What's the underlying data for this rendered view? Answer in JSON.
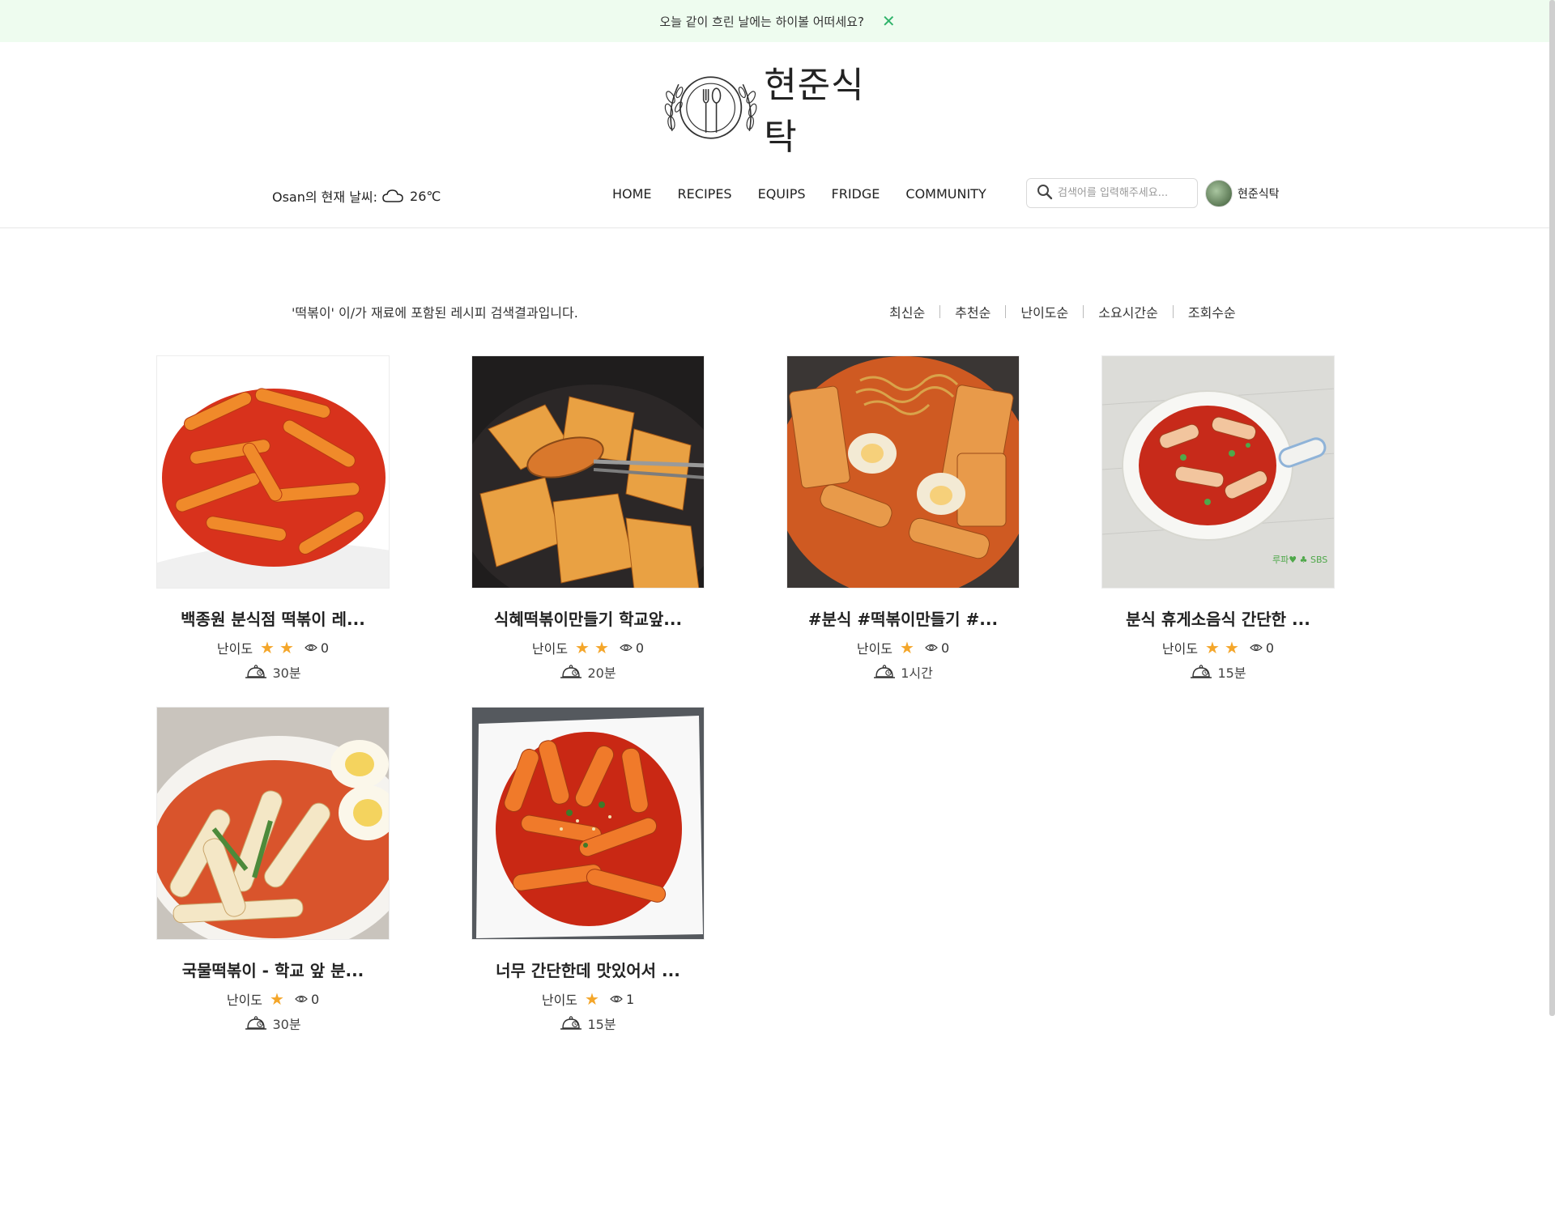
{
  "notice": {
    "text": "오늘 같이 흐린 날에는 하이볼 어떠세요?",
    "close": "✕"
  },
  "logo": {
    "text": "현준식탁"
  },
  "weather": {
    "label": "Osan의 현재 날씨:",
    "temp": "26℃"
  },
  "nav": {
    "home": "HOME",
    "recipes": "RECIPES",
    "equips": "EQUIPS",
    "fridge": "FRIDGE",
    "community": "COMMUNITY"
  },
  "search": {
    "placeholder": "검색어를 입력해주세요..."
  },
  "user": {
    "name": "현준식탁"
  },
  "result_text": "'떡볶이' 이/가 재료에 포함된 레시피 검색결과입니다.",
  "sort": {
    "latest": "최신순",
    "recommended": "추천순",
    "difficulty": "난이도순",
    "duration": "소요시간순",
    "views": "조회수순"
  },
  "difficulty_label": "난이도",
  "cards": [
    {
      "title": "백종원 분식점 떡볶이 레...",
      "stars": 2,
      "views": "0",
      "time": "30분"
    },
    {
      "title": "식혜떡볶이만들기 학교앞...",
      "stars": 2,
      "views": "0",
      "time": "20분"
    },
    {
      "title": "#분식 #떡볶이만들기 #...",
      "stars": 1,
      "views": "0",
      "time": "1시간"
    },
    {
      "title": "분식 휴게소음식 간단한 ...",
      "stars": 2,
      "views": "0",
      "time": "15분"
    },
    {
      "title": "국물떡볶이 - 학교 앞 분...",
      "stars": 1,
      "views": "0",
      "time": "30분"
    },
    {
      "title": "너무 간단한데 맛있어서 ...",
      "stars": 1,
      "views": "1",
      "time": "15분"
    }
  ],
  "colors": {
    "notice_bg": "#eefcef",
    "close": "#2fb36a",
    "star": "#f4a62a"
  }
}
